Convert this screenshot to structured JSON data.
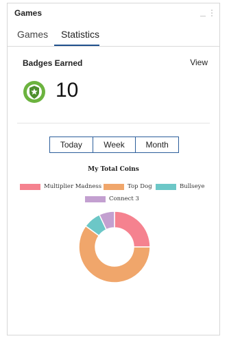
{
  "header": {
    "title": "Games"
  },
  "tabs": [
    {
      "label": "Games",
      "active": false
    },
    {
      "label": "Statistics",
      "active": true
    }
  ],
  "badges": {
    "title": "Badges Earned",
    "view_label": "View",
    "count": "10",
    "icon": "star-badge-icon",
    "icon_color": "#6cb33f"
  },
  "range": {
    "options": [
      "Today",
      "Week",
      "Month"
    ]
  },
  "chart_data": {
    "type": "pie",
    "title": "My Total Coins",
    "legend_placement": "top",
    "categories": [
      "Multiplier Madness",
      "Top Dog",
      "Bullseye",
      "Connect 3"
    ],
    "values": [
      25,
      60,
      8,
      7
    ],
    "colors": [
      "#f5828f",
      "#f0a66b",
      "#6cc7c7",
      "#c3a0d0"
    ]
  },
  "colors": {
    "accent": "#1e4f8c"
  }
}
